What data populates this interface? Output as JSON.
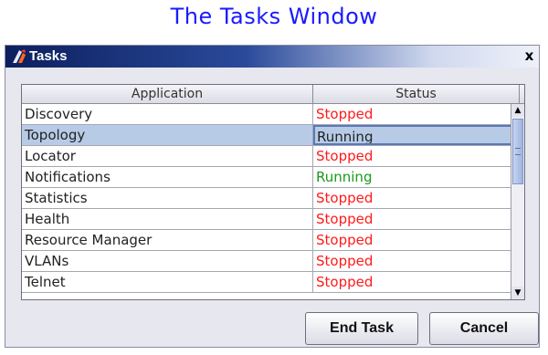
{
  "page": {
    "heading": "The Tasks Window"
  },
  "window": {
    "title": "Tasks",
    "close_glyph": "x",
    "icon": "app-logo-icon"
  },
  "table": {
    "columns": [
      "Application",
      "Status"
    ],
    "rows": [
      {
        "application": "Discovery",
        "status": "Stopped"
      },
      {
        "application": "Topology",
        "status": "Running",
        "selected": true
      },
      {
        "application": "Locator",
        "status": "Stopped"
      },
      {
        "application": "Notifications",
        "status": "Running"
      },
      {
        "application": "Statistics",
        "status": "Stopped"
      },
      {
        "application": "Health",
        "status": "Stopped"
      },
      {
        "application": "Resource Manager",
        "status": "Stopped"
      },
      {
        "application": "VLANs",
        "status": "Stopped"
      },
      {
        "application": "Telnet",
        "status": "Stopped"
      }
    ]
  },
  "status_colors": {
    "Stopped": "#ff1a1a",
    "Running": "#1a9a1a",
    "selected_running": "#222222"
  },
  "buttons": {
    "end_task": "End Task",
    "cancel": "Cancel"
  },
  "scrollbar": {
    "up_glyph": "▲",
    "down_glyph": "▼"
  }
}
